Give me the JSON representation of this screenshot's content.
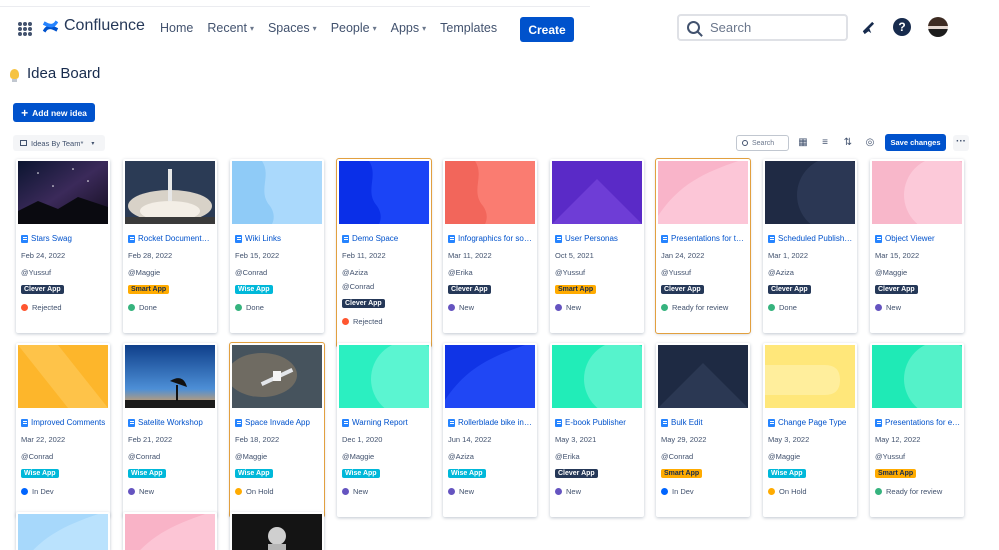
{
  "app": {
    "name": "Confluence"
  },
  "nav": [
    {
      "label": "Home",
      "menu": false
    },
    {
      "label": "Recent",
      "menu": true
    },
    {
      "label": "Spaces",
      "menu": true
    },
    {
      "label": "People",
      "menu": true
    },
    {
      "label": "Apps",
      "menu": true
    },
    {
      "label": "Templates",
      "menu": false
    }
  ],
  "create_label": "Create",
  "search": {
    "placeholder": "Search"
  },
  "page": {
    "title": "Idea Board",
    "add_label": "Add new idea",
    "view_label": "Ideas By Team*"
  },
  "toolbar": {
    "search_placeholder": "Search",
    "save_label": "Save changes"
  },
  "colors": {
    "brand": "#0052CC",
    "lozenges": {
      "Clever App": {
        "bg": "#253858",
        "fg": "#FFFFFF"
      },
      "Smart App": {
        "bg": "#FFAB00",
        "fg": "#172B4D"
      },
      "Wise App": {
        "bg": "#00B8D9",
        "fg": "#FFFFFF"
      }
    },
    "statuses": {
      "Rejected": "#FF5630",
      "Done": "#36B37E",
      "New": "#6554C0",
      "Ready for review": "#36B37E",
      "In Dev": "#0065FF",
      "On Hold": "#FFAB00"
    }
  },
  "cards": [
    {
      "title": "Stars Swag",
      "date": "Feb 24, 2022",
      "users": [
        "@Yussuf"
      ],
      "team": "Clever App",
      "status": "Rejected",
      "thumb": "night-sky-photo"
    },
    {
      "title": "Rocket Documentation",
      "date": "Feb 28, 2022",
      "users": [
        "@Maggie"
      ],
      "team": "Smart App",
      "status": "Done",
      "thumb": "rocket-launch-photo"
    },
    {
      "title": "Wiki Links",
      "date": "Feb 15, 2022",
      "users": [
        "@Conrad"
      ],
      "team": "Wise App",
      "status": "Done",
      "thumb": "light-blue-pattern"
    },
    {
      "title": "Demo Space",
      "date": "Feb 11, 2022",
      "users": [
        "@Aziza",
        "@Conrad"
      ],
      "team": "Clever App",
      "status": "Rejected",
      "thumb": "blue-pattern",
      "selected": true
    },
    {
      "title": "Infographics for social",
      "date": "Mar 11, 2022",
      "users": [
        "@Erika"
      ],
      "team": "Clever App",
      "status": "New",
      "thumb": "red-pattern"
    },
    {
      "title": "User Personas",
      "date": "Oct 5, 2021",
      "users": [
        "@Yussuf"
      ],
      "team": "Smart App",
      "status": "New",
      "thumb": "purple-pattern"
    },
    {
      "title": "Presentations for teams",
      "date": "Jan 24, 2022",
      "users": [
        "@Yussuf"
      ],
      "team": "Clever App",
      "status": "Ready for review",
      "thumb": "pink-pattern",
      "selected": true
    },
    {
      "title": "Scheduled Publishing",
      "date": "Mar 1, 2022",
      "users": [
        "@Aziza"
      ],
      "team": "Clever App",
      "status": "Done",
      "thumb": "navy-pattern"
    },
    {
      "title": "Object Viewer",
      "date": "Mar 15, 2022",
      "users": [
        "@Maggie"
      ],
      "team": "Clever App",
      "status": "New",
      "thumb": "pink-pattern-2"
    },
    {
      "title": "Improved Comments",
      "date": "Mar 22, 2022",
      "users": [
        "@Conrad"
      ],
      "team": "Wise App",
      "status": "In Dev",
      "thumb": "orange-pattern"
    },
    {
      "title": "Satelite Workshop",
      "date": "Feb 21, 2022",
      "users": [
        "@Conrad"
      ],
      "team": "Wise App",
      "status": "New",
      "thumb": "satellite-dish-photo"
    },
    {
      "title": "Space Invade App",
      "date": "Feb 18, 2022",
      "users": [
        "@Maggie"
      ],
      "team": "Wise App",
      "status": "On Hold",
      "thumb": "space-station-photo",
      "selected": true
    },
    {
      "title": "Warning Report",
      "date": "Dec 1, 2020",
      "users": [
        "@Maggie"
      ],
      "team": "Wise App",
      "status": "New",
      "thumb": "teal-pattern"
    },
    {
      "title": "Rollerblade bike integration",
      "date": "Jun 14, 2022",
      "users": [
        "@Aziza"
      ],
      "team": "Wise App",
      "status": "New",
      "thumb": "blue-pattern-2"
    },
    {
      "title": "E-book Publisher",
      "date": "May 3, 2021",
      "users": [
        "@Erika"
      ],
      "team": "Clever App",
      "status": "New",
      "thumb": "teal-pattern-2"
    },
    {
      "title": "Bulk Edit",
      "date": "May 29, 2022",
      "users": [
        "@Conrad"
      ],
      "team": "Smart App",
      "status": "In Dev",
      "thumb": "navy-pattern-2"
    },
    {
      "title": "Change Page Type",
      "date": "May 3, 2022",
      "users": [
        "@Maggie"
      ],
      "team": "Wise App",
      "status": "On Hold",
      "thumb": "yellow-pattern"
    },
    {
      "title": "Presentations for everyone",
      "date": "May 12, 2022",
      "users": [
        "@Yussuf"
      ],
      "team": "Smart App",
      "status": "Ready for review",
      "thumb": "teal-pattern-3"
    },
    {
      "thumb": "light-blue-pattern-2"
    },
    {
      "thumb": "pink-pattern-3"
    },
    {
      "thumb": "astronaut-photo"
    }
  ]
}
